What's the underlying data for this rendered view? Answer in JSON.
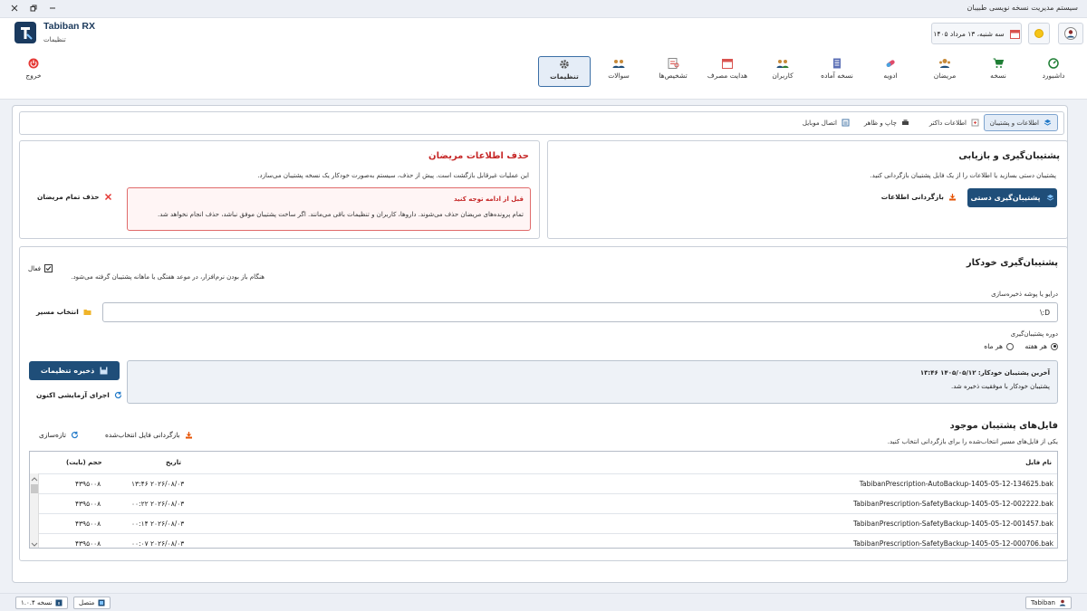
{
  "window": {
    "title": "سیستم مدیریت نسخه نویسی طبیبان"
  },
  "header": {
    "brand_name": "Tabiban RX",
    "brand_subtitle": "تنظیمات",
    "date": "سه شنبه، ۱۳ مرداد ۱۴۰۵"
  },
  "nav": {
    "items": [
      {
        "label": "داشبورد",
        "icon": "dashboard-icon"
      },
      {
        "label": "نسخه",
        "icon": "cart-icon"
      },
      {
        "label": "مریضان",
        "icon": "patients-icon"
      },
      {
        "label": "ادویه",
        "icon": "pill-icon"
      },
      {
        "label": "نسخه آماده",
        "icon": "document-icon"
      },
      {
        "label": "کاربران",
        "icon": "users-icon"
      },
      {
        "label": "هدایت مصرف",
        "icon": "calendar-icon"
      },
      {
        "label": "تشخیص‌ها",
        "icon": "diagnosis-icon"
      },
      {
        "label": "سوالات",
        "icon": "questions-icon"
      },
      {
        "label": "تنظیمات",
        "icon": "gear-icon",
        "active": true
      }
    ],
    "logout_label": "خروج"
  },
  "tabs": [
    {
      "label": "اطلاعات و پشتیبان",
      "active": true
    },
    {
      "label": "اطلاعات داکتر"
    },
    {
      "label": "چاپ و ظاهر"
    },
    {
      "label": "اتصال موبایل"
    }
  ],
  "backup_card": {
    "title": "پشتیبان‌گیری و بازیابی",
    "desc": "پشتیبان دستی بسازید یا اطلاعات را از یک فایل پشتیبان بازگردانی کنید.",
    "manual_backup_label": "پشتیبان‌گیری دستی",
    "restore_label": "بازگردانی اطلاعات"
  },
  "delete_card": {
    "title": "حذف اطلاعات مریضان",
    "desc": "این عملیات غیرقابل بازگشت است. پیش از حذف، سیستم به‌صورت خودکار یک نسخه پشتیبان می‌سازد.",
    "warn_title": "قبل از ادامه توجه کنید",
    "warn_text": "تمام پرونده‌های مریضان حذف می‌شوند. داروها، کاربران و تنظیمات باقی می‌مانند. اگر ساخت پشتیبان موفق نباشد، حذف انجام نخواهد شد.",
    "delete_all_label": "حذف تمام مریضان"
  },
  "auto_backup": {
    "title": "پشتیبان‌گیری خودکار",
    "enabled_label": "فعال",
    "enabled_checked": true,
    "desc": "هنگام باز بودن نرم‌افزار، در موعد هفتگی یا ماهانه پشتیبان گرفته می‌شود.",
    "folder_label": "درایو یا پوشه ذخیره‌سازی",
    "folder_value": "D:\\",
    "select_path_label": "انتخاب مسیر",
    "period_label": "دوره پشتیبان‌گیری",
    "period_options": [
      "هر هفته",
      "هر ماه"
    ],
    "period_selected": "هر هفته",
    "last_backup": "آخرین پشتیبان خودکار: ۱۴۰۵/۰۵/۱۲ ۱۳:۴۶",
    "last_backup_status": "پشتیبان خودکار با موفقیت ذخیره شد.",
    "save_label": "ذخیره تنظیمات",
    "test_run_label": "اجرای آزمایشی اکنون"
  },
  "files": {
    "title": "فایل‌های پشتیبان موجود",
    "desc": "یکی از فایل‌های مسیر انتخاب‌شده را برای بازگردانی انتخاب کنید.",
    "restore_selected_label": "بازگردانی فایل انتخاب‌شده",
    "refresh_label": "تازه‌سازی",
    "columns": [
      "نام فایل",
      "تاریخ",
      "حجم (بایت)"
    ],
    "rows": [
      {
        "name": "TabibanPrescription-AutoBackup-1405-05-12-134625.bak",
        "date": "۲۰۲۶/۰۸/۰۳ ۱۳:۴۶",
        "size": "۴۳۹۵۰۰۸"
      },
      {
        "name": "TabibanPrescription-SafetyBackup-1405-05-12-002222.bak",
        "date": "۲۰۲۶/۰۸/۰۳ ۰۰:۲۲",
        "size": "۴۳۹۵۰۰۸"
      },
      {
        "name": "TabibanPrescription-SafetyBackup-1405-05-12-001457.bak",
        "date": "۲۰۲۶/۰۸/۰۳ ۰۰:۱۴",
        "size": "۴۳۹۵۰۰۸"
      },
      {
        "name": "TabibanPrescription-SafetyBackup-1405-05-12-000706.bak",
        "date": "۲۰۲۶/۰۸/۰۳ ۰۰:۰۷",
        "size": "۴۳۹۵۰۰۸"
      }
    ]
  },
  "statusbar": {
    "version": "نسخه ۱.۰.۴",
    "connection": "متصل",
    "user": "Tabiban"
  },
  "colors": {
    "primary": "#1f4e79",
    "danger": "#c62828",
    "accent_bg": "#e3ecf7"
  }
}
